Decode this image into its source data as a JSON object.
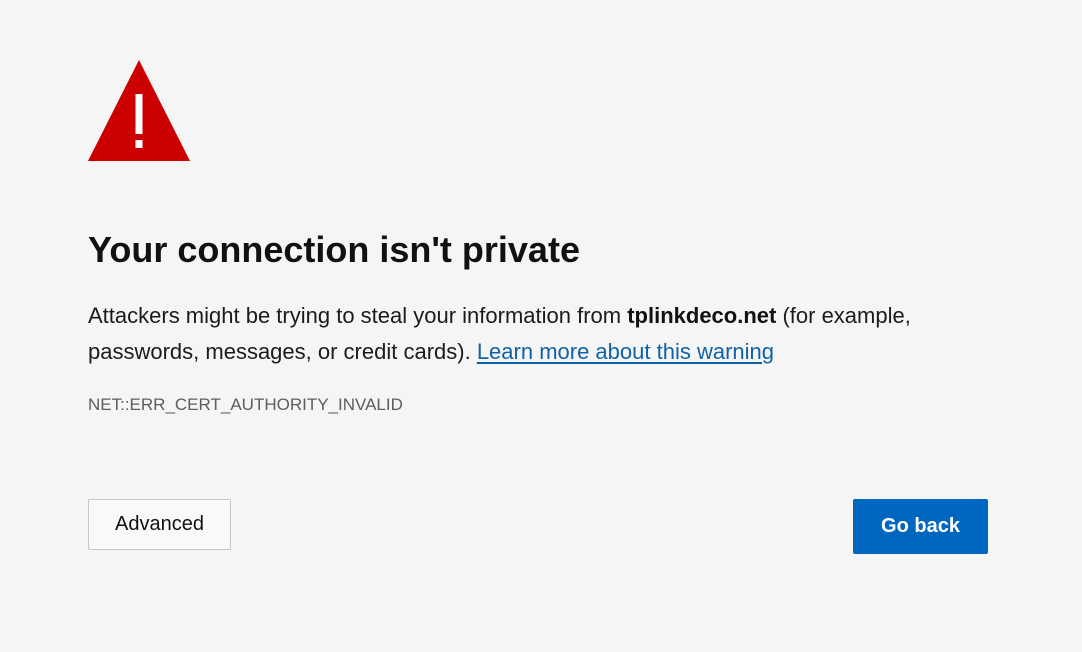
{
  "page": {
    "title": "Your connection isn't private",
    "message_before": "Attackers might be trying to steal your information from ",
    "host": "tplinkdeco.net",
    "message_after": " (for example, passwords, messages, or credit cards). ",
    "learn_more_link": "Learn more about this warning",
    "error_code": "NET::ERR_CERT_AUTHORITY_INVALID"
  },
  "buttons": {
    "advanced_label": "Advanced",
    "go_back_label": "Go back"
  },
  "icons": {
    "warning": "warning-triangle-icon"
  },
  "colors": {
    "background": "#f5f5f5",
    "warning_red": "#cc0000",
    "link": "#0f62a8",
    "primary_button": "#0067c0",
    "error_code_text": "#5d5d5d"
  }
}
